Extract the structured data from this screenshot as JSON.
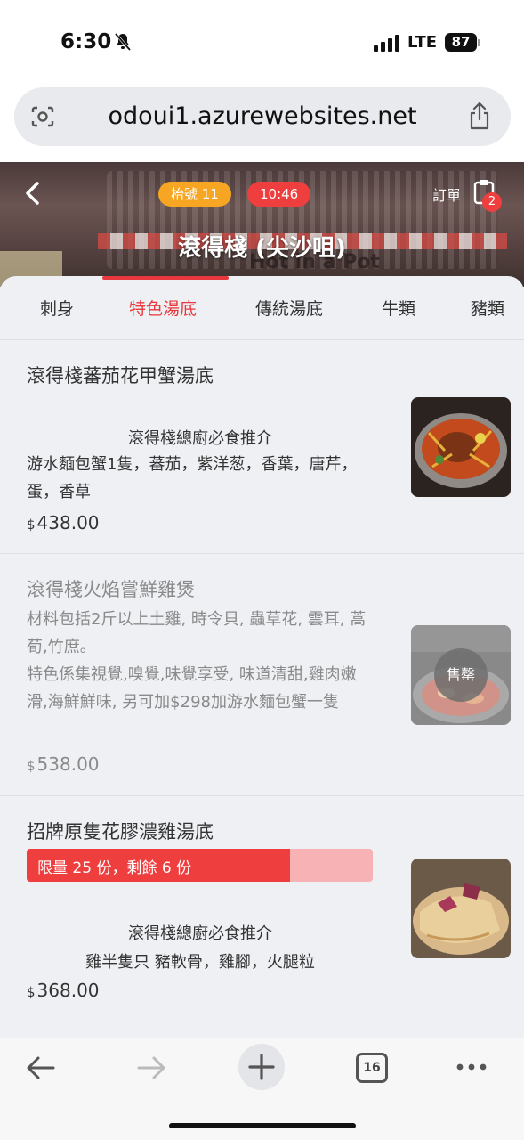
{
  "status_bar": {
    "time": "6:30",
    "network": "LTE",
    "battery": "87"
  },
  "browser": {
    "url": "odoui1.azurewebsites.net",
    "open_tabs": "16"
  },
  "header": {
    "table_tag": "枱號 11",
    "time_tag": "10:46",
    "order_label": "訂單",
    "order_count": "2",
    "shop_name": "滾得棧 (尖沙咀)",
    "banner_sign": "Hot in a Pot"
  },
  "tabs": [
    {
      "label": "刺身",
      "active": false
    },
    {
      "label": "特色湯底",
      "active": true
    },
    {
      "label": "傳統湯底",
      "active": false
    },
    {
      "label": "牛類",
      "active": false
    },
    {
      "label": "豬類",
      "active": false
    }
  ],
  "items": [
    {
      "name": "滾得棧蕃茄花甲蟹湯底",
      "subtitle": "滾得棧總廚必食推介",
      "description": "游水麵包蟹1隻，蕃茄，紫洋葱，香葉，唐芹，蛋，香草",
      "currency": "$",
      "price": "438.00",
      "sold_out": false
    },
    {
      "name": "滾得棧火焰嘗鮮雞煲",
      "description_lines": [
        "材料包括2斤以上土雞, 時令貝, 蟲草花, 雲耳, 蒿荀,竹庶。",
        "特色係集視覺,嗅覺,味覺享受, 味道清甜,雞肉嫩滑,海鮮鮮味, 另可加$298加游水麵包蟹一隻"
      ],
      "currency": "$",
      "price": "538.00",
      "sold_out": true,
      "sold_out_label": "售罄"
    },
    {
      "name": "招牌原隻花膠濃雞湯底",
      "limit_text": "限量 25 份，剩餘 6 份",
      "limit_total": 25,
      "limit_remaining": 6,
      "limit_fill_fraction": 0.76,
      "subtitle": "滾得棧總廚必食推介",
      "description": "雞半隻只 豬軟骨，雞腳，火腿粒",
      "currency": "$",
      "price": "368.00",
      "sold_out": false
    }
  ],
  "colors": {
    "accent": "#e8383d",
    "table_tag": "#f6a623",
    "time_tag": "#ef3e3e",
    "limit_bg": "#f6b2b4"
  }
}
